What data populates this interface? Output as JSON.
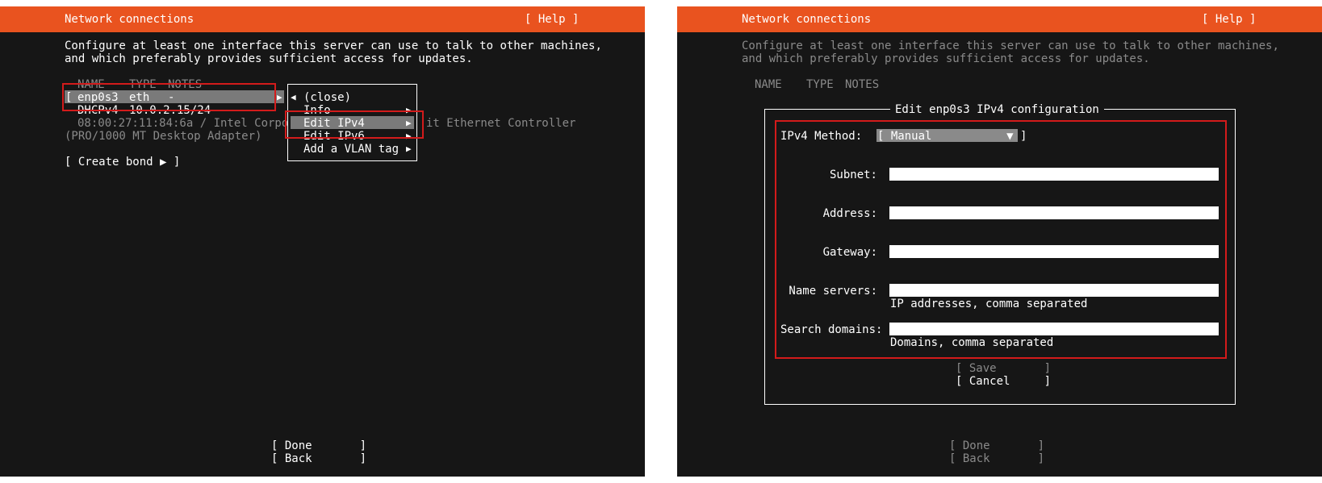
{
  "left": {
    "header": {
      "title": "Network connections",
      "help": "[ Help ]"
    },
    "intro": [
      "Configure at least one interface this server can use to talk to other machines,",
      "and which preferably provides sufficient access for updates."
    ],
    "columns": {
      "name": "NAME",
      "type": "TYPE",
      "notes": "NOTES"
    },
    "interface": {
      "bracket": "[",
      "name": "enp0s3",
      "type": "eth",
      "notes": "-",
      "arrow": "▶",
      "addr_type": "DHCPv4",
      "addr": "10.0.2.15/24",
      "hw_line1_a": "08:00:27:11:84:6a / Intel Corpor",
      "hw_line1_b": "it Ethernet Controller",
      "hw_line2": "(PRO/1000 MT Desktop Adapter)"
    },
    "menu": {
      "close_arrow": "◀",
      "close": "(close)",
      "items": [
        {
          "label": "Info",
          "arrow": "▶"
        },
        {
          "label": "Edit IPv4",
          "arrow": "▶"
        },
        {
          "label": "Edit IPv6",
          "arrow": "▶"
        },
        {
          "label": "Add a VLAN tag",
          "arrow": "▶"
        }
      ]
    },
    "create_bond": "[ Create bond ▶ ]",
    "done": "[ Done       ]",
    "back": "[ Back       ]"
  },
  "right": {
    "header": {
      "title": "Network connections",
      "help": "[ Help ]"
    },
    "intro": [
      "Configure at least one interface this server can use to talk to other machines,",
      "and which preferably provides sufficient access for updates."
    ],
    "columns": {
      "name": "NAME",
      "type": "TYPE",
      "notes": "NOTES"
    },
    "dialog": {
      "title": "Edit enp0s3 IPv4 configuration",
      "method_label": "IPv4 Method:",
      "method_value": "[ Manual           ▼ ]",
      "fields": [
        {
          "label": "Subnet:",
          "value": "",
          "hint": ""
        },
        {
          "label": "Address:",
          "value": "",
          "hint": ""
        },
        {
          "label": "Gateway:",
          "value": "",
          "hint": ""
        },
        {
          "label": "Name servers:",
          "value": "",
          "hint": "IP addresses, comma separated"
        },
        {
          "label": "Search domains:",
          "value": "",
          "hint": "Domains, comma separated"
        }
      ],
      "save": "[ Save       ]",
      "cancel": "[ Cancel     ]"
    },
    "done": "[ Done       ]",
    "back": "[ Back       ]"
  },
  "colors": {
    "header": "#e9531f",
    "background": "#161616",
    "highlight": "#7a7a7a",
    "annotation": "#d31b1b"
  }
}
